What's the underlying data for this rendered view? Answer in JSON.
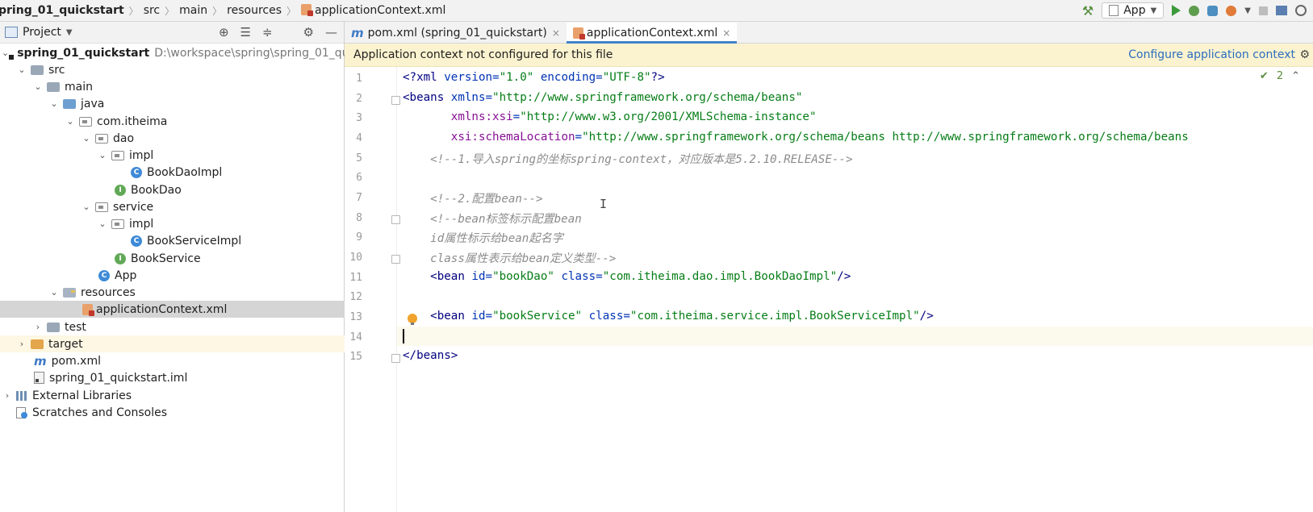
{
  "breadcrumb": {
    "items": [
      "pring_01_quickstart",
      "src",
      "main",
      "resources",
      "applicationContext.xml"
    ]
  },
  "toolbar": {
    "run_config": "App"
  },
  "project_panel": {
    "title": "Project",
    "tree": [
      {
        "label": "spring_01_quickstart",
        "extra": "D:\\workspace\\spring\\spring_01_quic"
      },
      {
        "label": "src"
      },
      {
        "label": "main"
      },
      {
        "label": "java"
      },
      {
        "label": "com.itheima"
      },
      {
        "label": "dao"
      },
      {
        "label": "impl"
      },
      {
        "label": "BookDaoImpl"
      },
      {
        "label": "BookDao"
      },
      {
        "label": "service"
      },
      {
        "label": "impl"
      },
      {
        "label": "BookServiceImpl"
      },
      {
        "label": "BookService"
      },
      {
        "label": "App"
      },
      {
        "label": "resources"
      },
      {
        "label": "applicationContext.xml"
      },
      {
        "label": "test"
      },
      {
        "label": "target"
      },
      {
        "label": "pom.xml"
      },
      {
        "label": "spring_01_quickstart.iml"
      },
      {
        "label": "External Libraries"
      },
      {
        "label": "Scratches and Consoles"
      }
    ]
  },
  "editor": {
    "tabs": [
      {
        "label": "pom.xml (spring_01_quickstart)"
      },
      {
        "label": "applicationContext.xml"
      }
    ],
    "banner": {
      "message": "Application context not configured for this file",
      "link": "Configure application context"
    },
    "inspection_count": "2",
    "line_numbers": [
      "1",
      "2",
      "3",
      "4",
      "5",
      "6",
      "7",
      "8",
      "9",
      "10",
      "11",
      "12",
      "13",
      "14",
      "15"
    ],
    "lines": {
      "l1_open": "<?",
      "l1_xml": "xml",
      "l1_version_attr": " version=",
      "l1_version_val": "\"1.0\"",
      "l1_enc_attr": " encoding=",
      "l1_enc_val": "\"UTF-8\"",
      "l1_close": "?>",
      "l2_tag": "<beans",
      "l2_attr": " xmlns=",
      "l2_val": "\"http://www.springframework.org/schema/beans\"",
      "l3_indent": "       ",
      "l3_ns": "xmlns:xsi",
      "l3_eq": "=",
      "l3_val": "\"http://www.w3.org/2001/XMLSchema-instance\"",
      "l4_indent": "       ",
      "l4_ns": "xsi:schemaLocation",
      "l4_eq": "=",
      "l4_val": "\"http://www.springframework.org/schema/beans http://www.springframework.org/schema/beans",
      "l5": "    <!--1.导入spring的坐标spring-context，对应版本是5.2.10.RELEASE-->",
      "l7": "    <!--2.配置bean-->",
      "l8": "    <!--bean标签标示配置bean",
      "l9": "    id属性标示给bean起名字",
      "l10": "    class属性表示给bean定义类型-->",
      "l11_indent": "    ",
      "l11_tag": "<bean",
      "l11_id_attr": " id=",
      "l11_id_val": "\"bookDao\"",
      "l11_class_attr": " class=",
      "l11_class_val": "\"com.itheima.dao.impl.BookDaoImpl\"",
      "l11_close": "/>",
      "l13_indent": "    ",
      "l13_tag": "<bean",
      "l13_id_attr": " id=",
      "l13_id_val": "\"bookService\"",
      "l13_class_attr": " class=",
      "l13_class_val": "\"com.itheima.service.impl.BookServiceImpl\"",
      "l13_close": "/>",
      "l15": "</beans>"
    }
  }
}
